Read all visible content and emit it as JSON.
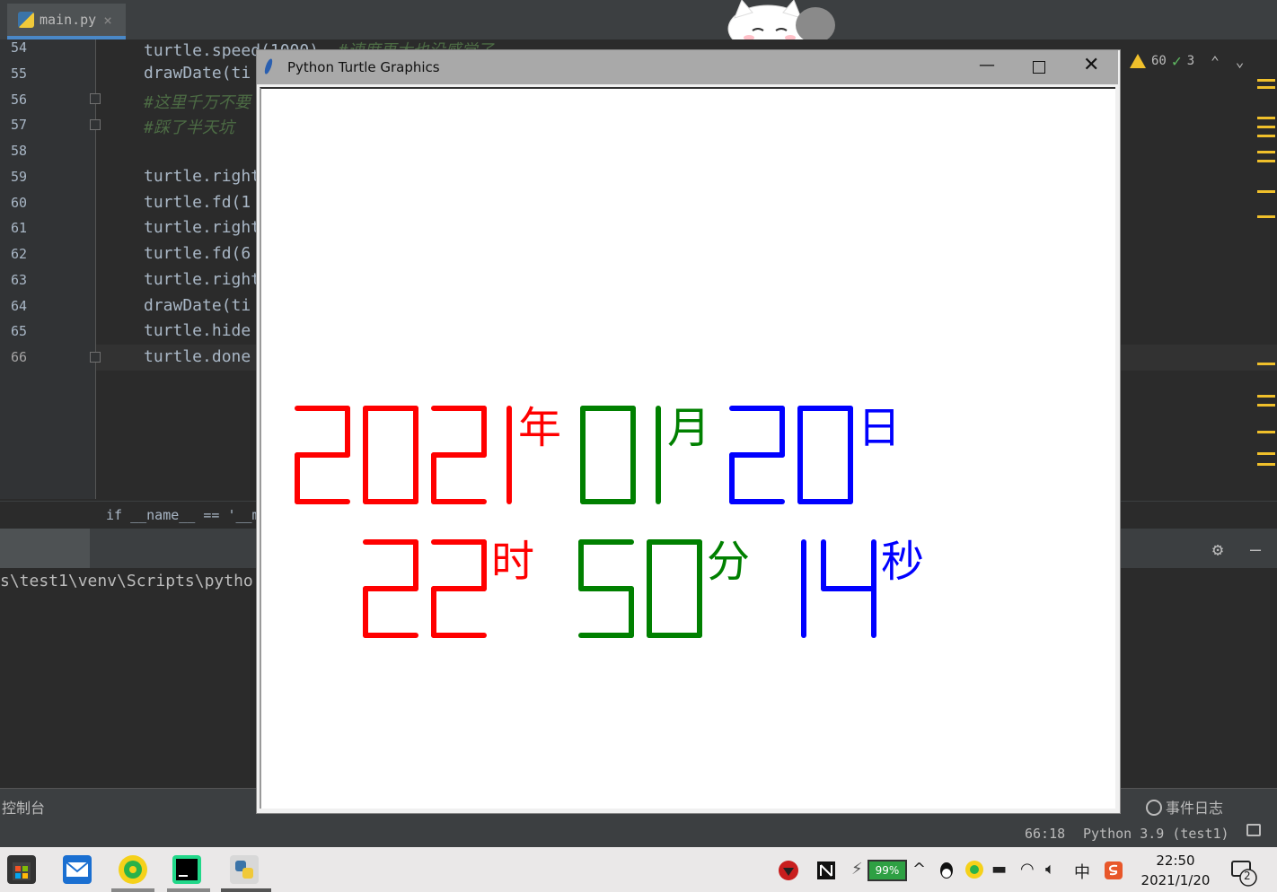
{
  "editor": {
    "tab_label": "main.py",
    "tab_close": "×",
    "lines": [
      {
        "num": "54",
        "code": "turtle.speed(1000)",
        "comment": "#速度再大也没感觉了"
      },
      {
        "num": "55",
        "code": "drawDate(ti"
      },
      {
        "num": "56",
        "code": "",
        "comment": "#这里千万不要"
      },
      {
        "num": "57",
        "code": "",
        "comment": "#踩了半天坑"
      },
      {
        "num": "58",
        "code": ""
      },
      {
        "num": "59",
        "code": "turtle.right"
      },
      {
        "num": "60",
        "code": "turtle.fd(1"
      },
      {
        "num": "61",
        "code": "turtle.right"
      },
      {
        "num": "62",
        "code": "turtle.fd(6"
      },
      {
        "num": "63",
        "code": "turtle.right"
      },
      {
        "num": "64",
        "code": "drawDate(ti"
      },
      {
        "num": "65",
        "code": "turtle.hide"
      },
      {
        "num": "66",
        "code": "turtle.done"
      }
    ],
    "breadcrumb": "if __name__ == '__m",
    "warnings": "60",
    "checks": "3"
  },
  "console": {
    "text": "s\\test1\\venv\\Scripts\\pytho",
    "tab_console": "控制台",
    "tab_event_log": "事件日志"
  },
  "statusbar": {
    "position": "66:18",
    "interpreter": "Python 3.9 (test1)"
  },
  "turtle_window": {
    "title": "Python Turtle Graphics",
    "minimize": "—",
    "close": "✕",
    "date_row": [
      {
        "digits": "2021",
        "unit": "年",
        "color": "#ff0000"
      },
      {
        "digits": "01",
        "unit": "月",
        "color": "#008000"
      },
      {
        "digits": "20",
        "unit": "日",
        "color": "#0000ff"
      }
    ],
    "time_row": [
      {
        "digits": "22",
        "unit": "时",
        "color": "#ff0000"
      },
      {
        "digits": "50",
        "unit": "分",
        "color": "#008000"
      },
      {
        "digits": "14",
        "unit": "秒",
        "color": "#0000ff"
      }
    ]
  },
  "taskbar": {
    "battery": "99%",
    "ime": "中",
    "time": "22:50",
    "date": "2021/1/20",
    "notifications": "2"
  }
}
